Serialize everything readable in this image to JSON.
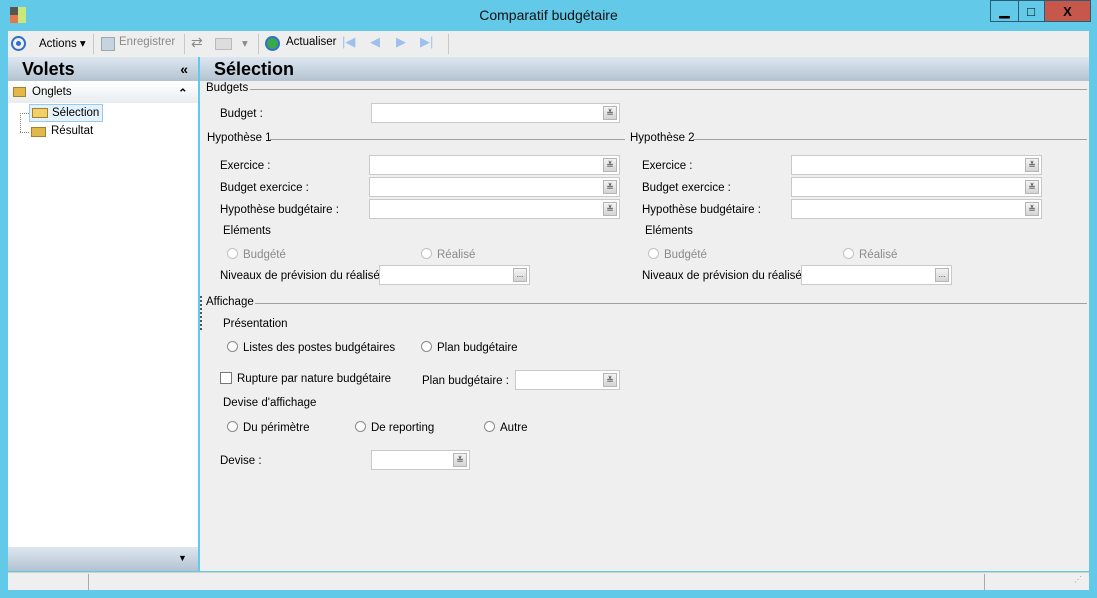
{
  "window": {
    "title": "Comparatif budgétaire",
    "minimize": "▁",
    "maximize": "□",
    "close": "X",
    "close_color": "#c8574b"
  },
  "toolbar": {
    "actions": "Actions",
    "save": "Enregistrer",
    "refresh": "Actualiser"
  },
  "sidebar": {
    "title": "Volets",
    "collapse": "«",
    "section": "Onglets",
    "section_toggle": "⌃",
    "items": [
      {
        "label": "Sélection",
        "selected": true
      },
      {
        "label": "Résultat",
        "selected": false
      }
    ],
    "footer_arrow": "▼"
  },
  "main": {
    "title": "Sélection",
    "budgets": {
      "group": "Budgets",
      "budget_label": "Budget :",
      "budget_value": ""
    },
    "hyp1": {
      "group": "Hypothèse 1",
      "exercice": "Exercice :",
      "budget_exercice": "Budget exercice :",
      "hypothese": "Hypothèse budgétaire :",
      "elements": "Eléments",
      "budgete": "Budgété",
      "realise": "Réalisé",
      "niveaux": "Niveaux de prévision du réalisé :"
    },
    "hyp2": {
      "group": "Hypothèse 2",
      "exercice": "Exercice :",
      "budget_exercice": "Budget exercice :",
      "hypothese": "Hypothèse budgétaire :",
      "elements": "Eléments",
      "budgete": "Budgété",
      "realise": "Réalisé",
      "niveaux": "Niveaux de prévision du réalisé :"
    },
    "affichage": {
      "group": "Affichage",
      "presentation": "Présentation",
      "listes": "Listes des postes budgétaires",
      "plan": "Plan budgétaire",
      "rupture": "Rupture par nature budgétaire",
      "plan_label": "Plan budgétaire :",
      "devise_affichage": "Devise d'affichage",
      "perimetre": "Du périmètre",
      "reporting": "De reporting",
      "autre": "Autre",
      "devise_label": "Devise :"
    },
    "ellipsis": "..."
  }
}
